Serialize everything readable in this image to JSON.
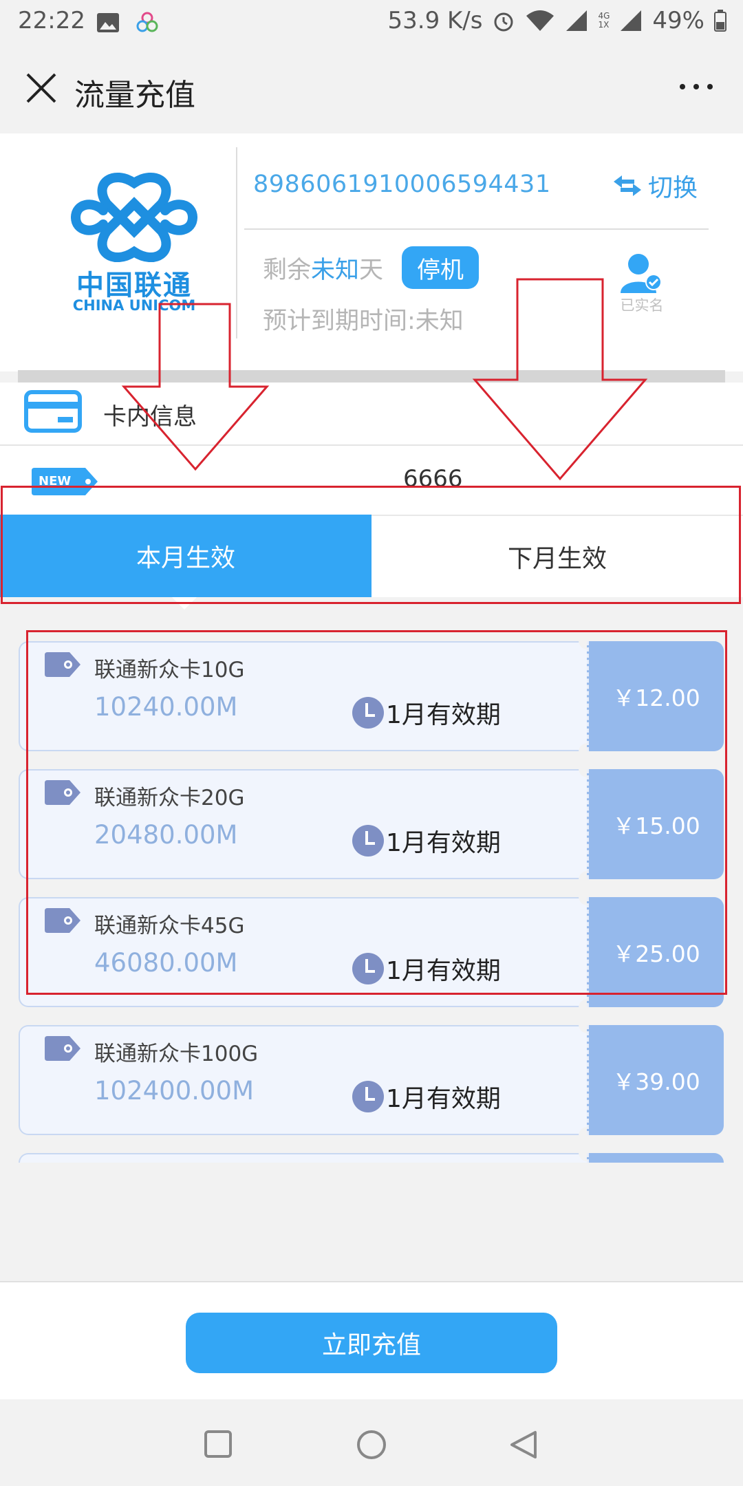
{
  "status_bar": {
    "time": "22:22",
    "network_speed": "53.9 K/s",
    "network_type": "4G",
    "network_sub": "1X",
    "battery": "49%"
  },
  "header": {
    "title": "流量充值"
  },
  "card": {
    "brand_cn": "中国联通",
    "brand_en": "CHINA UNICOM",
    "iccid": "89860619100065944​31",
    "switch_label": "切换",
    "remaining_prefix": "剩余",
    "remaining_value": "未知",
    "remaining_suffix": "天",
    "status_badge": "停机",
    "expire_text": "预计到期时间:未知",
    "verified_label": "已实名"
  },
  "info": {
    "label": "卡内信息",
    "new_badge": "NEW",
    "new_value": "6666"
  },
  "tabs": {
    "this_month": "本月生效",
    "next_month": "下月生效"
  },
  "plans": [
    {
      "name": "联通新众卡10G",
      "size": "10240.00M",
      "validity": "1月有效期",
      "price": "￥12.00"
    },
    {
      "name": "联通新众卡20G",
      "size": "20480.00M",
      "validity": "1月有效期",
      "price": "￥15.00"
    },
    {
      "name": "联通新众卡45G",
      "size": "46080.00M",
      "validity": "1月有效期",
      "price": "￥25.00"
    },
    {
      "name": "联通新众卡100G",
      "size": "102400.00M",
      "validity": "1月有效期",
      "price": "￥39.00"
    }
  ],
  "action": {
    "recharge_label": "立即充值"
  },
  "colors": {
    "accent": "#33a6f5",
    "price_box": "#95b9ec",
    "annotation": "#d8232f"
  }
}
